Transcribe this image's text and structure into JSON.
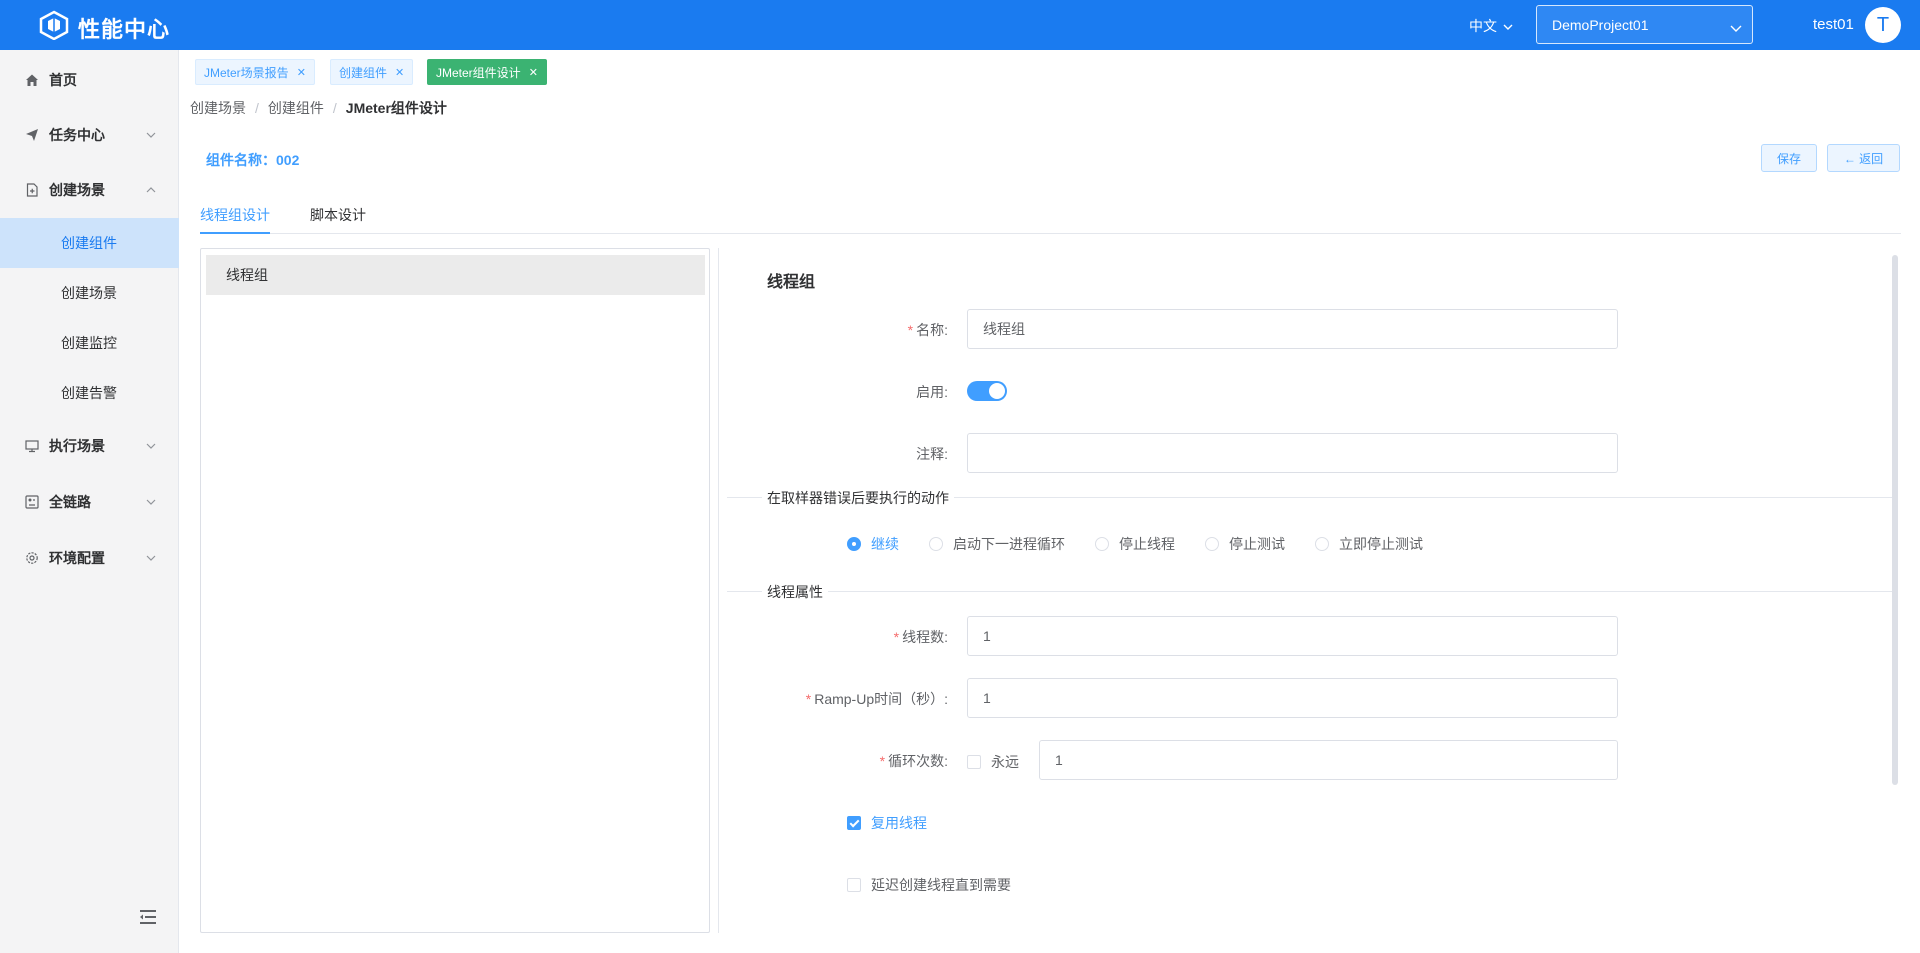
{
  "header": {
    "app_title": "性能中心",
    "language": "中文",
    "project": "DemoProject01",
    "username": "test01",
    "avatar_letter": "T",
    "accent_color": "#1a7bf0"
  },
  "sidebar": {
    "items": [
      {
        "label": "首页",
        "icon": "home-icon"
      },
      {
        "label": "任务中心",
        "icon": "send-icon"
      },
      {
        "label": "创建场景",
        "icon": "file-add-icon"
      },
      {
        "label": "执行场景",
        "icon": "monitor-icon"
      },
      {
        "label": "全链路",
        "icon": "dashboard-icon"
      },
      {
        "label": "环境配置",
        "icon": "gear-icon"
      }
    ],
    "sub_items": [
      {
        "label": "创建组件",
        "active": true
      },
      {
        "label": "创建场景"
      },
      {
        "label": "创建监控"
      },
      {
        "label": "创建告警"
      }
    ]
  },
  "tags": [
    {
      "label": "JMeter场景报告"
    },
    {
      "label": "创建组件"
    },
    {
      "label": "JMeter组件设计",
      "active": true
    }
  ],
  "breadcrumb": [
    "创建场景",
    "创建组件",
    "JMeter组件设计"
  ],
  "component": {
    "name_label": "组件名称：",
    "name_value": "002"
  },
  "actions": {
    "save": "保存",
    "back": "← 返回"
  },
  "tabs": [
    "线程组设计",
    "脚本设计"
  ],
  "tree": {
    "node": "线程组"
  },
  "form": {
    "title": "线程组",
    "name_label": "名称:",
    "name_value": "线程组",
    "enable_label": "启用:",
    "enable_on": true,
    "comment_label": "注释:",
    "comment_value": "",
    "error_section": "在取样器错误后要执行的动作",
    "error_options": [
      "继续",
      "启动下一进程循环",
      "停止线程",
      "停止测试",
      "立即停止测试"
    ],
    "error_selected": "继续",
    "thread_section": "线程属性",
    "threads_label": "线程数:",
    "threads_value": "1",
    "rampup_label": "Ramp-Up时间（秒）:",
    "rampup_value": "1",
    "loop_label": "循环次数:",
    "forever_label": "永远",
    "loop_value": "1",
    "reuse_label": "复用线程",
    "reuse_checked": true,
    "delay_label": "延迟创建线程直到需要",
    "delay_checked": false
  }
}
